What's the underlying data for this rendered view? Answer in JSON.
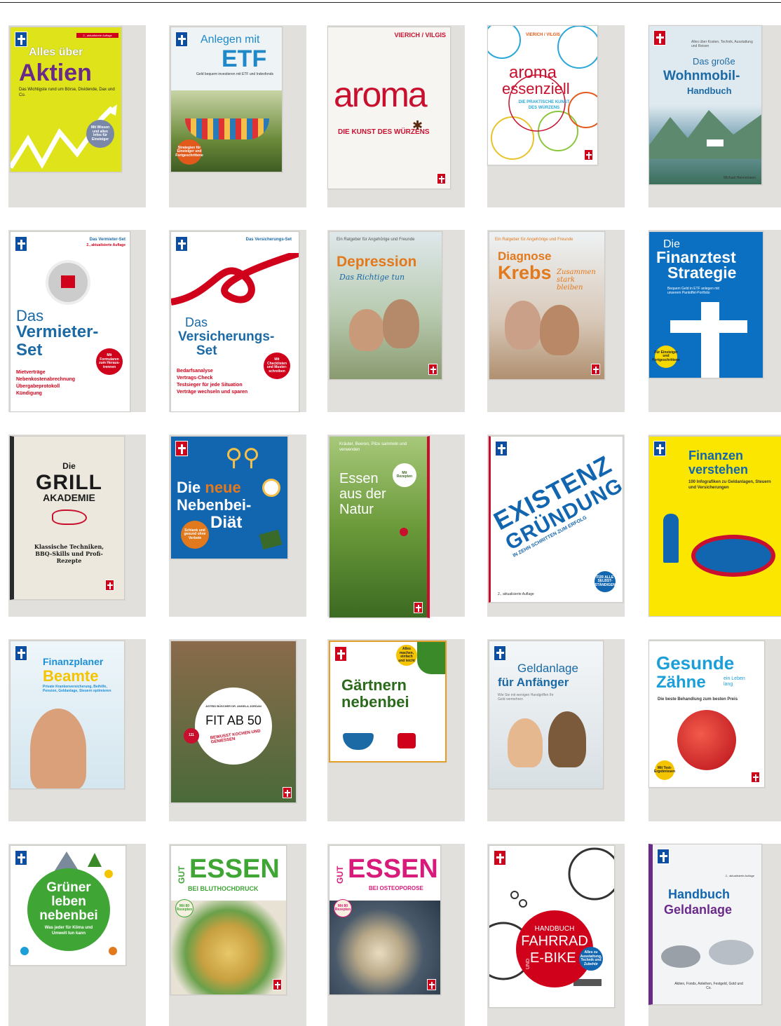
{
  "books": [
    {
      "title1": "Alles über",
      "title2": "Aktien",
      "sub": "Das Wichtigste rund um Börse, Dividende, Dax und Co.",
      "edition": "2., aktualisierte Auflage",
      "badge": "Mit Wissen und allen Infos für Einsteiger"
    },
    {
      "title1": "Anlegen mit",
      "title2": "ETF",
      "sub": "Geld bequem investieren mit ETF und Indexfonds",
      "badge": "Strategien für Einsteiger und Fortgeschrittene"
    },
    {
      "authors": "VIERICH / VILGIS",
      "title2": "aroma",
      "sub": "DIE KUNST DES WÜRZENS"
    },
    {
      "authors": "VIERICH / VILGIS",
      "title1": "aroma",
      "title2": "essenziell",
      "sub": "DIE PRAKTISCHE KUNST DES WÜRZENS"
    },
    {
      "sup": "Alles über Kosten, Technik, Ausstattung und Reisen",
      "title1": "Das große",
      "title2": "Wohnmobil-",
      "title3": "Handbuch",
      "author": "Michael Hennemann"
    },
    {
      "kicker1": "Das",
      "kicker2": "Vermieter-Set",
      "edition": "2., aktualisierte Auflage",
      "title1": "Das",
      "title2": "Vermieter-",
      "title3": "Set",
      "items": [
        "Mietverträge",
        "Nebenkostenabrechnung",
        "Übergabeprotokoll",
        "Kündigung"
      ],
      "badge": "Mit Formularen zum Heraus-trennen"
    },
    {
      "kicker1": "Das",
      "kicker2": "Versicherungs-Set",
      "title1": "Das",
      "title2": "Versicherungs-",
      "title3": "Set",
      "items": [
        "Bedarfsanalyse",
        "Vertrags-Check",
        "Testsieger für jede Situation",
        "Verträge wechseln und sparen"
      ],
      "badge": "Mit Checklisten und Muster-schreiben"
    },
    {
      "sup": "Ein Ratgeber für Angehörige und Freunde",
      "title1": "Depression",
      "script": "Das Richtige tun"
    },
    {
      "sup": "Ein Ratgeber für Angehörige und Freunde",
      "title1": "Diagnose",
      "title2": "Krebs",
      "script": "Zusammen stark bleiben"
    },
    {
      "title1": "Die",
      "title2": "Finanztest",
      "title3": "Strategie",
      "sub": "Bequem Geld in ETF anlegen mit unserem Pantoffel-Portfolio",
      "badge": "Für Einsteiger und Fortgeschrittene"
    },
    {
      "title1": "Die",
      "title2": "GRILL",
      "title3": "AKADEMIE",
      "sub": "Klassische Techniken, BBQ-Skills und Profi-Rezepte"
    },
    {
      "title1": "Die",
      "title2": "neue",
      "title3": "Nebenbei-",
      "title4": "Diät",
      "badge": "Schlank und gesund ohne Verbote"
    },
    {
      "sup": "Kräuter, Beeren, Pilze sammeln und verwenden",
      "title1": "Essen",
      "title2": "aus der",
      "title3": "Natur",
      "badge": "Mit Rezepten"
    },
    {
      "title1": "EXISTENZ",
      "title2": "GRÜNDUNG",
      "sub": "IN ZEHN SCHRITTEN ZUM ERFOLG",
      "edition": "2., aktualisierte Auflage",
      "badge": "FÜR ALLE SELBST-STÄNDIGEN"
    },
    {
      "title1": "Finanzen",
      "title2": "verstehen",
      "sub": "100 Infografiken zu Geldanlagen, Steuern und Versicherungen"
    },
    {
      "title1": "Finanzplaner",
      "title2": "Beamte",
      "sub": "Private Krankenversicherung, Beihilfe, Pension, Geldanlage, Steuern optimieren"
    },
    {
      "authors": "ASTRID BÜSCHER  DR. ANGELA JORDAN",
      "title1": "FIT AB 50",
      "sub": "BEWUSST KOCHEN UND GENIESSEN",
      "badge": "111"
    },
    {
      "title1": "Gärtnern",
      "title2": "nebenbei",
      "badge": "Alles machen, einfach und leicht"
    },
    {
      "title1": "Geldanlage",
      "title2": "für Anfänger",
      "sub": "Wie Sie mit wenigen Handgriffen Ihr Geld vermehren"
    },
    {
      "title1": "Gesunde",
      "title2": "Zähne",
      "title3": "ein Leben lang",
      "sub": "Die beste Behandlung zum besten Preis",
      "badge": "Mit Test-Ergebnissen"
    },
    {
      "title1": "Grüner",
      "title2": "leben",
      "title3": "nebenbei",
      "sub": "Was jeder für Klima und Umwelt tun kann"
    },
    {
      "title1": "GUT",
      "title2": "ESSEN",
      "sub": "BEI BLUTHOCHDRUCK",
      "badge": "Mit 80 Rezepten"
    },
    {
      "title1": "GUT",
      "title2": "ESSEN",
      "sub": "BEI OSTEOPOROSE",
      "badge": "Mit 80 Rezepten"
    },
    {
      "title1": "HANDBUCH",
      "title2": "FAHRRAD",
      "title3": "UND",
      "title4": "E-BIKE",
      "badge": "Alles zu Ausstattung, Technik und Zubehör"
    },
    {
      "edition": "2., aktualisierte Auflage",
      "title1": "Handbuch",
      "title2": "Geldanlage",
      "sub": "Aktien, Fonds, Anleihen, Festgeld, Gold und Co."
    }
  ]
}
